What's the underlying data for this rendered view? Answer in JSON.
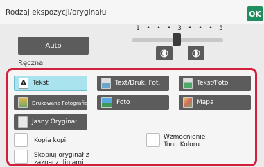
{
  "header": {
    "title": "Rodzaj ekspozycji/oryginału",
    "ok_label": "OK"
  },
  "exposure": {
    "auto_label": "Auto",
    "manual_label": "Ręczna",
    "scale_labels": [
      "1",
      "•",
      "•",
      "•",
      "3",
      "•",
      "•",
      "•",
      "5"
    ],
    "level": 3
  },
  "original_types": [
    {
      "label": "Tekst",
      "icon": "text-A-icon",
      "selected": true
    },
    {
      "label": "Text/Druk. Fot.",
      "icon": "text-print-photo-icon",
      "selected": false
    },
    {
      "label": "Tekst/Foto",
      "icon": "text-photo-icon",
      "selected": false
    },
    {
      "label": "Drukowana Fotografia",
      "icon": "printed-photo-icon",
      "selected": false
    },
    {
      "label": "Foto",
      "icon": "photo-icon",
      "selected": false
    },
    {
      "label": "Mapa",
      "icon": "map-icon",
      "selected": false
    },
    {
      "label": "Jasny Oryginał",
      "icon": "light-original-icon",
      "selected": false
    }
  ],
  "checkboxes": [
    {
      "label": "Kopia kopii",
      "checked": false
    },
    {
      "label": "Wzmocnienie\nTonu Koloru",
      "checked": false
    },
    {
      "label": "Skopiuj oryginał z\nzaznacz. liniami",
      "checked": false
    }
  ],
  "colors": {
    "ok_button": "#1f8f5f",
    "selected_option": "#a9e3ee",
    "panel_border": "#d21f3c",
    "dark_button": "#5c5c5c"
  }
}
